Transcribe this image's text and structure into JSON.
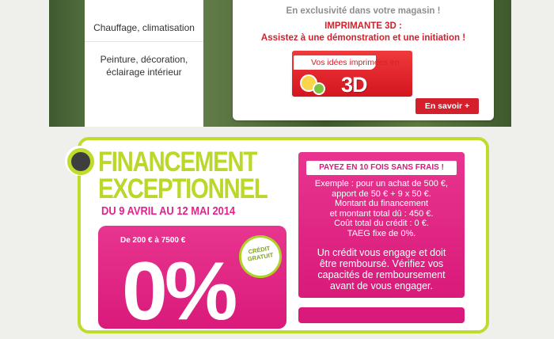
{
  "menu": {
    "items": [
      "Chauffage, climatisation",
      "Peinture, décoration,\néclairage intérieur"
    ]
  },
  "promo": {
    "exclusive": "En exclusivité dans votre magasin !",
    "title": "IMPRIMANTE 3D :",
    "subtitle": "Assistez à une démonstration et une initiation !",
    "badge_line": "Vos idées imprimées en",
    "badge_3d": "3D",
    "more_button": "En savoir +"
  },
  "financing": {
    "title_line1": "FINANCEMENT",
    "title_line2": "EXCEPTIONNEL",
    "dates": "DU 9 AVRIL AU 12 MAI 2014",
    "range": "De 200 € à 7500 €",
    "rate": "0%",
    "sticker_line1": "CRÉDIT",
    "sticker_line2": "GRATUIT",
    "badge": "PAYEZ EN 10 FOIS SANS FRAIS !",
    "example": [
      "Exemple : pour un achat de 500 €,",
      "apport de 50 € + 9 x 50 €.",
      "Montant du financement",
      "et montant total dû : 450 €.",
      "Coût total du crédit : 0 €.",
      "TAEG fixe de 0%."
    ],
    "warning": [
      "Un crédit vous engage et doit",
      "être remboursé. Vérifiez vos",
      "capacités de remboursement",
      "avant de vous engager."
    ]
  },
  "colors": {
    "accent_green": "#bfdb2b",
    "accent_pink": "#e3238b",
    "accent_red": "#d3202c"
  }
}
